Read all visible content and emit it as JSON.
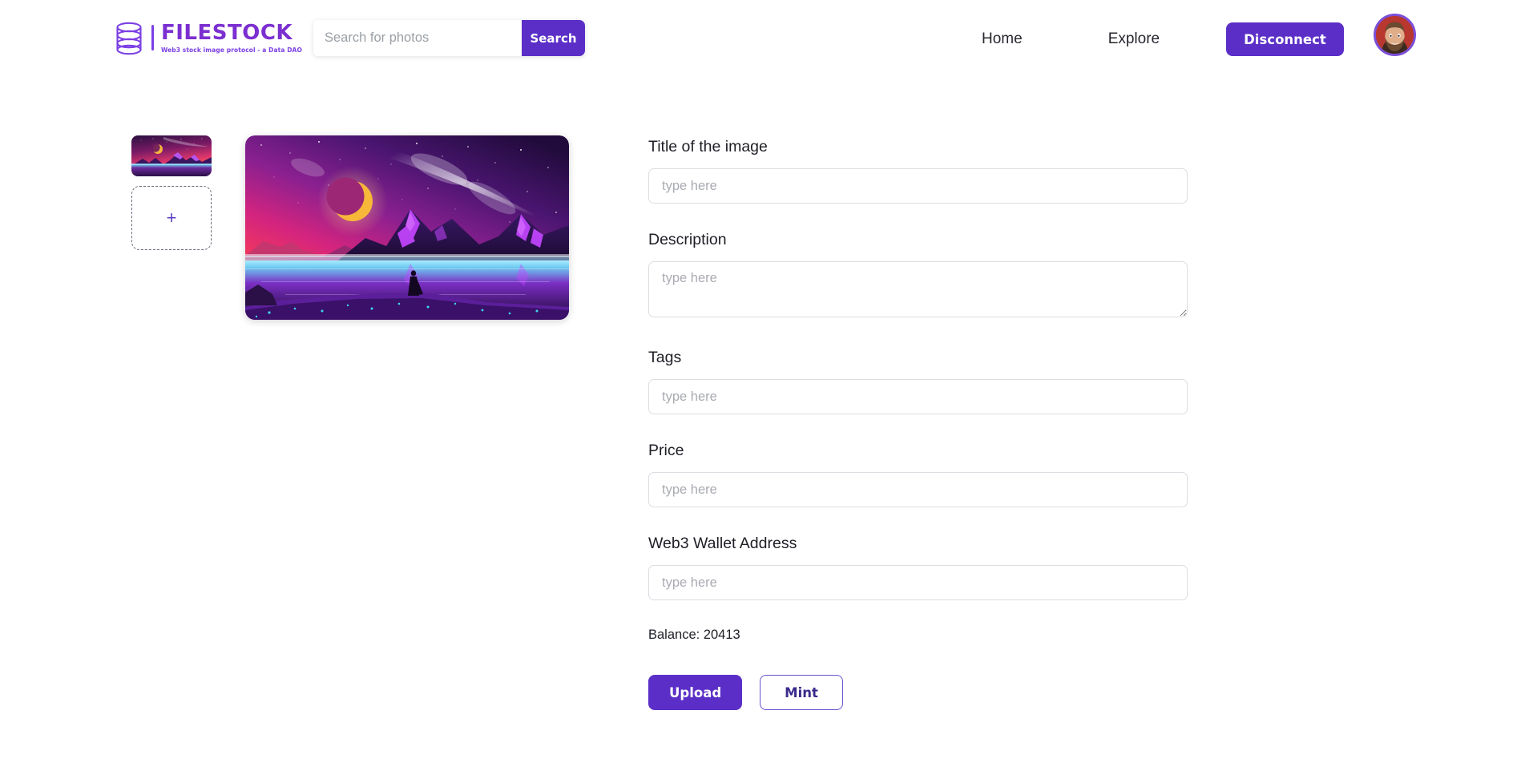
{
  "brand": {
    "word": "FILESTOCK",
    "tagline": "Web3 stock image protocol - a Data DAO",
    "logo_icon": "database-stack-icon",
    "accent_color": "#5b2fc7",
    "logo_color": "#7b2fd0"
  },
  "search": {
    "placeholder": "Search for photos",
    "value": "",
    "button_label": "Search"
  },
  "nav": {
    "home_label": "Home",
    "explore_label": "Explore",
    "disconnect_label": "Disconnect",
    "avatar_name": "user-avatar"
  },
  "gallery": {
    "thumbnail_alt": "cosmic-landscape-thumbnail",
    "add_image_label": "+",
    "hero_alt": "cosmic-landscape-preview"
  },
  "form": {
    "fields": [
      {
        "label": "Title of the image",
        "placeholder": "type here",
        "value": "",
        "name": "title"
      },
      {
        "label": "Description",
        "placeholder": "type here",
        "value": "",
        "name": "description"
      },
      {
        "label": "Tags",
        "placeholder": "type here",
        "value": "",
        "name": "tags"
      },
      {
        "label": "Price",
        "placeholder": "type here",
        "value": "",
        "name": "price"
      },
      {
        "label": "Web3 Wallet Address",
        "placeholder": "type here",
        "value": "",
        "name": "wallet"
      }
    ],
    "balance_text": "Balance: 20413",
    "upload_label": "Upload",
    "mint_label": "Mint"
  }
}
